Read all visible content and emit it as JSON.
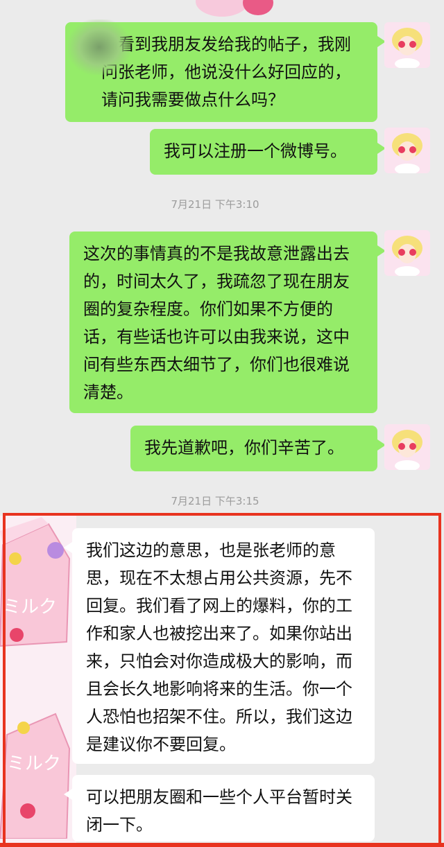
{
  "messages": [
    {
      "text": "我看到我朋友发给我的帖子，我刚问张老师，他说没什么好回应的，请问我需要做点什么吗？"
    },
    {
      "text": "我可以注册一个微博号。"
    },
    {
      "text": "这次的事情真的不是我故意泄露出去的，时间太久了，我疏忽了现在朋友圈的复杂程度。你们如果不方便的话，有些话也许可以由我来说，这中间有些东西太细节了，你们也很难说清楚。"
    },
    {
      "text": "我先道歉吧，你们辛苦了。"
    },
    {
      "text": "我们这边的意思，也是张老师的意思，现在不太想占用公共资源，先不回复。我们看了网上的爆料，你的工作和家人也被挖出来了。如果你站出来，只怕会对你造成极大的影响，而且会长久地影响将来的生活。你一个人恐怕也招架不住。所以，我们这边是建议你不要回复。"
    },
    {
      "text": "可以把朋友圈和一些个人平台暂时关闭一下。"
    }
  ],
  "timestamps": [
    "7月21日 下午3:10",
    "7月21日 下午3:15"
  ],
  "sticker_text": "ミルク",
  "colors": {
    "sent_bubble": "#95ec69",
    "received_bubble": "#ffffff",
    "highlight_border": "#e8331f",
    "background": "#ebebeb"
  }
}
